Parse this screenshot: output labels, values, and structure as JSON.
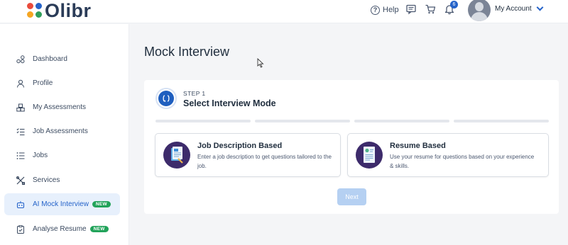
{
  "header": {
    "brand": "Olibr",
    "help_label": "Help",
    "notification_count": "6",
    "account_label": "My Account",
    "brand_colors": [
      "#e94b3c",
      "#f5a623",
      "#2f9e5b",
      "#2563c9"
    ]
  },
  "sidebar": {
    "items": [
      {
        "label": "Dashboard",
        "icon": "dashboard-icon"
      },
      {
        "label": "Profile",
        "icon": "user-icon"
      },
      {
        "label": "My Assessments",
        "icon": "assessments-icon"
      },
      {
        "label": "Job Assessments",
        "icon": "checklist-icon"
      },
      {
        "label": "Jobs",
        "icon": "list-icon"
      },
      {
        "label": "Services",
        "icon": "tools-icon"
      },
      {
        "label": "AI Mock Interview",
        "icon": "robot-icon",
        "badge": "NEW",
        "active": true
      },
      {
        "label": "Analyse Resume",
        "icon": "clipboard-check-icon",
        "badge": "NEW"
      }
    ]
  },
  "main": {
    "title": "Mock Interview",
    "step": {
      "label": "STEP 1",
      "title": "Select Interview Mode",
      "progress_total": 4
    },
    "options": [
      {
        "title": "Job Description Based",
        "description": "Enter a job description to get questions tailored to the job.",
        "icon": "document-icon"
      },
      {
        "title": "Resume Based",
        "description": "Use your resume for questions based on your experience & skills.",
        "icon": "resume-icon"
      }
    ],
    "next_label": "Next",
    "accent": "#2563c9"
  }
}
